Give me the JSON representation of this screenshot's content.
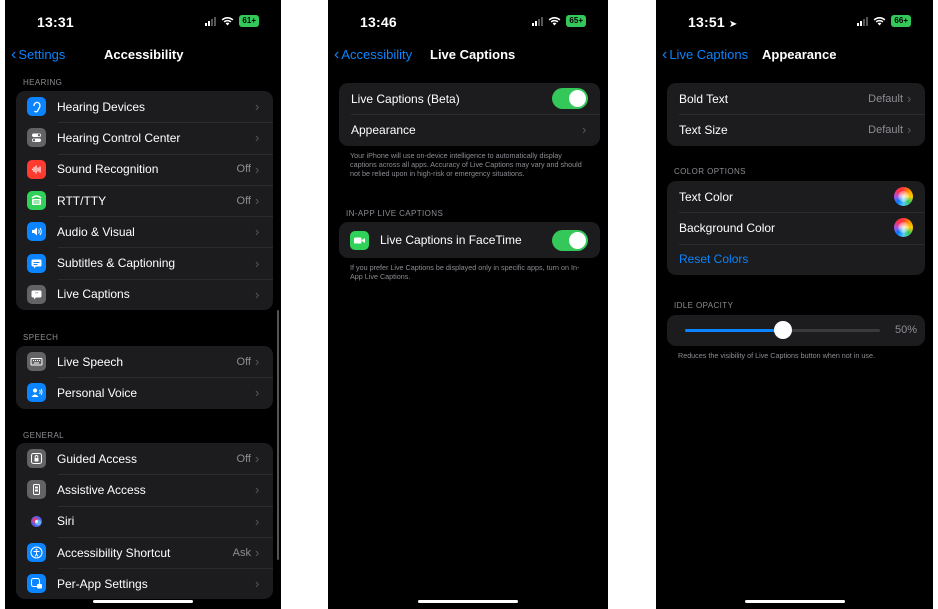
{
  "screen1": {
    "time": "13:31",
    "battery": "61+",
    "back_label": "Settings",
    "title": "Accessibility",
    "hearing_label": "HEARING",
    "hearing_items": [
      {
        "label": "Hearing Devices",
        "value": "",
        "icon": "ear-icon",
        "color": "#0a84ff"
      },
      {
        "label": "Hearing Control Center",
        "value": "",
        "icon": "toggle-switches-icon",
        "color": "#636366"
      },
      {
        "label": "Sound Recognition",
        "value": "Off",
        "icon": "sound-wave-icon",
        "color": "#ff3b30"
      },
      {
        "label": "RTT/TTY",
        "value": "Off",
        "icon": "tty-icon",
        "color": "#30d158"
      },
      {
        "label": "Audio & Visual",
        "value": "",
        "icon": "speaker-eye-icon",
        "color": "#0a84ff"
      },
      {
        "label": "Subtitles & Captioning",
        "value": "",
        "icon": "caption-bubble-icon",
        "color": "#0a84ff"
      },
      {
        "label": "Live Captions",
        "value": "",
        "icon": "quote-bubble-icon",
        "color": "#636366"
      }
    ],
    "speech_label": "SPEECH",
    "speech_items": [
      {
        "label": "Live Speech",
        "value": "Off",
        "icon": "keyboard-icon",
        "color": "#636366"
      },
      {
        "label": "Personal Voice",
        "value": "",
        "icon": "person-voice-icon",
        "color": "#0a84ff"
      }
    ],
    "general_label": "GENERAL",
    "general_items": [
      {
        "label": "Guided Access",
        "value": "Off",
        "icon": "lock-frame-icon",
        "color": "#636366"
      },
      {
        "label": "Assistive Access",
        "value": "",
        "icon": "phone-frame-icon",
        "color": "#636366"
      },
      {
        "label": "Siri",
        "value": "",
        "icon": "siri-icon",
        "color": "#1c1c1e"
      },
      {
        "label": "Accessibility Shortcut",
        "value": "Ask",
        "icon": "accessibility-icon",
        "color": "#0a84ff"
      },
      {
        "label": "Per-App Settings",
        "value": "",
        "icon": "app-settings-icon",
        "color": "#0a84ff"
      }
    ]
  },
  "screen2": {
    "time": "13:46",
    "battery": "65+",
    "back_label": "Accessibility",
    "title": "Live Captions",
    "toggle_label": "Live Captions (Beta)",
    "appearance_label": "Appearance",
    "footnote1": "Your iPhone will use on-device intelligence to automatically display captions across all apps. Accuracy of Live Captions may vary and should not be relied upon in high-risk or emergency situations.",
    "in_app_label": "IN-APP LIVE CAPTIONS",
    "facetime_label": "Live Captions in FaceTime",
    "footnote2": "If you prefer Live Captions be displayed only in specific apps, turn on In-App Live Captions."
  },
  "screen3": {
    "time": "13:51",
    "battery": "66+",
    "back_label": "Live Captions",
    "title": "Appearance",
    "bold_text_label": "Bold Text",
    "bold_text_value": "Default",
    "text_size_label": "Text Size",
    "text_size_value": "Default",
    "color_options_label": "COLOR OPTIONS",
    "text_color_label": "Text Color",
    "background_color_label": "Background Color",
    "reset_colors_label": "Reset Colors",
    "idle_opacity_label": "IDLE OPACITY",
    "idle_opacity_value": "50%",
    "idle_opacity_fraction": 0.5,
    "footnote": "Reduces the visibility of Live Captions button when not in use."
  },
  "colors": {
    "accent": "#0a84ff",
    "toggle_on": "#34c759",
    "group_bg": "#1c1c1e"
  }
}
